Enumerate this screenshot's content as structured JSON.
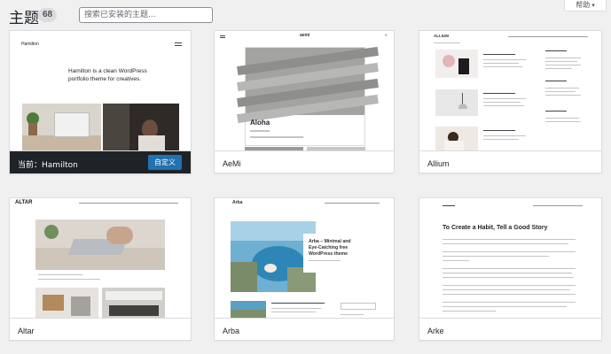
{
  "header": {
    "title": "主题",
    "count": "68",
    "search_placeholder": "搜索已安装的主题...",
    "help_label": "帮助"
  },
  "themes": [
    {
      "name": "Hamilton",
      "active": true,
      "active_prefix": "当前：",
      "customize_label": "自定义",
      "preview": {
        "site_title": "Hamilton",
        "headline_1": "Hamilton is a clean WordPress",
        "headline_2": "portfolio theme for creatives."
      }
    },
    {
      "name": "AeMi",
      "active": false,
      "preview": {
        "logo": "aemi",
        "post_title": "Aloha"
      }
    },
    {
      "name": "Allium",
      "active": false,
      "preview": {
        "site_title": "ALLIUM"
      }
    },
    {
      "name": "Altar",
      "active": false,
      "preview": {
        "logo": "ALTAR"
      }
    },
    {
      "name": "Arba",
      "active": false,
      "preview": {
        "logo": "Arba",
        "hero_1": "Arba – Minimal and",
        "hero_2": "Eye-Catching free",
        "hero_3": "WordPress theme"
      }
    },
    {
      "name": "Arke",
      "active": false,
      "preview": {
        "post_title": "To Create a Habit, Tell a Good Story"
      }
    }
  ],
  "colors": {
    "background": "#f0f0f1",
    "active_bar": "#1d2327",
    "button_blue": "#2271b1"
  }
}
